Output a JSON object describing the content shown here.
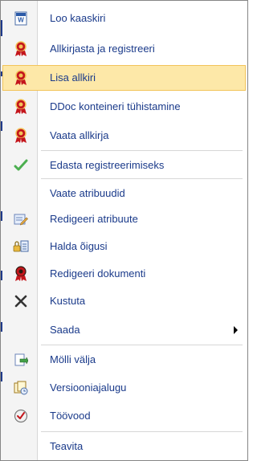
{
  "menu": {
    "items": [
      {
        "label": "Loo kaaskiri",
        "icon": "word-document-icon"
      },
      {
        "label": "Allkirjasta ja registreeri",
        "icon": "certificate-ribbon-icon"
      },
      {
        "label": "Lisa allkiri",
        "icon": "certificate-ribbon-icon",
        "highlighted": true
      },
      {
        "label": "DDoc konteineri tühistamine",
        "icon": "certificate-ribbon-icon"
      },
      {
        "label": "Vaata allkirja",
        "icon": "certificate-ribbon-icon"
      },
      {
        "label": "Edasta registreerimiseks",
        "icon": "checkmark-icon"
      },
      {
        "label": "Vaate atribuudid",
        "icon": ""
      },
      {
        "label": "Redigeeri atribuute",
        "icon": "edit-properties-icon"
      },
      {
        "label": "Halda õigusi",
        "icon": "manage-permissions-icon"
      },
      {
        "label": "Redigeeri dokumenti",
        "icon": "certificate-ribbon-icon"
      },
      {
        "label": "Kustuta",
        "icon": "delete-x-icon"
      },
      {
        "label": "Saada",
        "icon": "",
        "has_submenu": true
      },
      {
        "label": "Mölli välja",
        "icon": "check-out-icon"
      },
      {
        "label": "Versiooniajalugu",
        "icon": "version-history-icon"
      },
      {
        "label": "Töövood",
        "icon": "workflow-icon"
      },
      {
        "label": "Teavita",
        "icon": ""
      }
    ]
  },
  "colors": {
    "label_text": "#1a3a8a",
    "highlight_bg": "#fde8a8",
    "highlight_border": "#f2c45a",
    "ribbon_red": "#c4161c",
    "check_green": "#4caf50"
  }
}
